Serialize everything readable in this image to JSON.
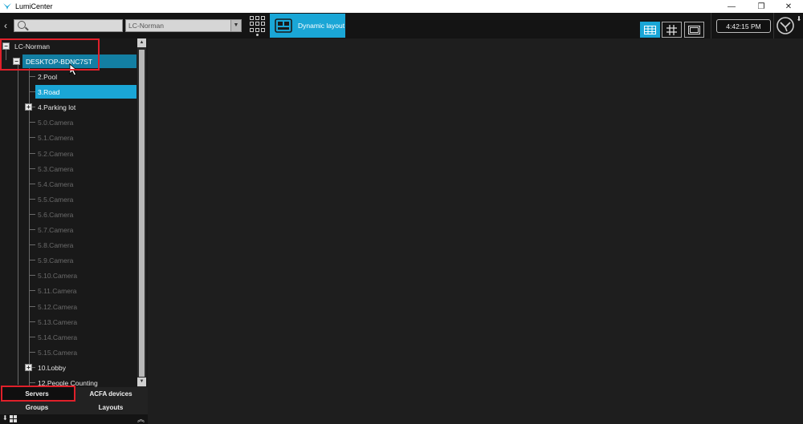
{
  "app": {
    "title": "LumiCenter"
  },
  "window_controls": {
    "minimize": "—",
    "restore": "❐",
    "close": "✕"
  },
  "toolbar": {
    "back_symbol": "‹",
    "search_placeholder": "",
    "server_select_value": "LC-Norman",
    "dynamic_layout_label": "Dynamic layout",
    "clock": "4:42:15 PM",
    "pin_symbol": "⬇"
  },
  "tree": {
    "root": "LC-Norman",
    "server": "DESKTOP-BDNC7ST",
    "items": [
      {
        "label": "2.Pool",
        "state": "normal"
      },
      {
        "label": "3.Road",
        "state": "selected"
      },
      {
        "label": "4.Parking lot",
        "state": "normal",
        "expandable": true
      },
      {
        "label": "5.0.Camera",
        "state": "disabled"
      },
      {
        "label": "5.1.Camera",
        "state": "disabled"
      },
      {
        "label": "5.2.Camera",
        "state": "disabled"
      },
      {
        "label": "5.3.Camera",
        "state": "disabled"
      },
      {
        "label": "5.4.Camera",
        "state": "disabled"
      },
      {
        "label": "5.5.Camera",
        "state": "disabled"
      },
      {
        "label": "5.6.Camera",
        "state": "disabled"
      },
      {
        "label": "5.7.Camera",
        "state": "disabled"
      },
      {
        "label": "5.8.Camera",
        "state": "disabled"
      },
      {
        "label": "5.9.Camera",
        "state": "disabled"
      },
      {
        "label": "5.10.Camera",
        "state": "disabled"
      },
      {
        "label": "5.11.Camera",
        "state": "disabled"
      },
      {
        "label": "5.12.Camera",
        "state": "disabled"
      },
      {
        "label": "5.13.Camera",
        "state": "disabled"
      },
      {
        "label": "5.14.Camera",
        "state": "disabled"
      },
      {
        "label": "5.15.Camera",
        "state": "disabled"
      },
      {
        "label": "10.Lobby",
        "state": "normal",
        "expandable": true
      },
      {
        "label": "12.People Counting",
        "state": "normal"
      }
    ]
  },
  "tabs": {
    "servers": "Servers",
    "acfa_devices": "ACFA devices",
    "groups": "Groups",
    "layouts": "Layouts"
  },
  "colors": {
    "accent": "#1aa6d6",
    "highlight_red": "#e0202a",
    "server_row": "#137fa3",
    "disabled_text": "#6b6b6b"
  }
}
